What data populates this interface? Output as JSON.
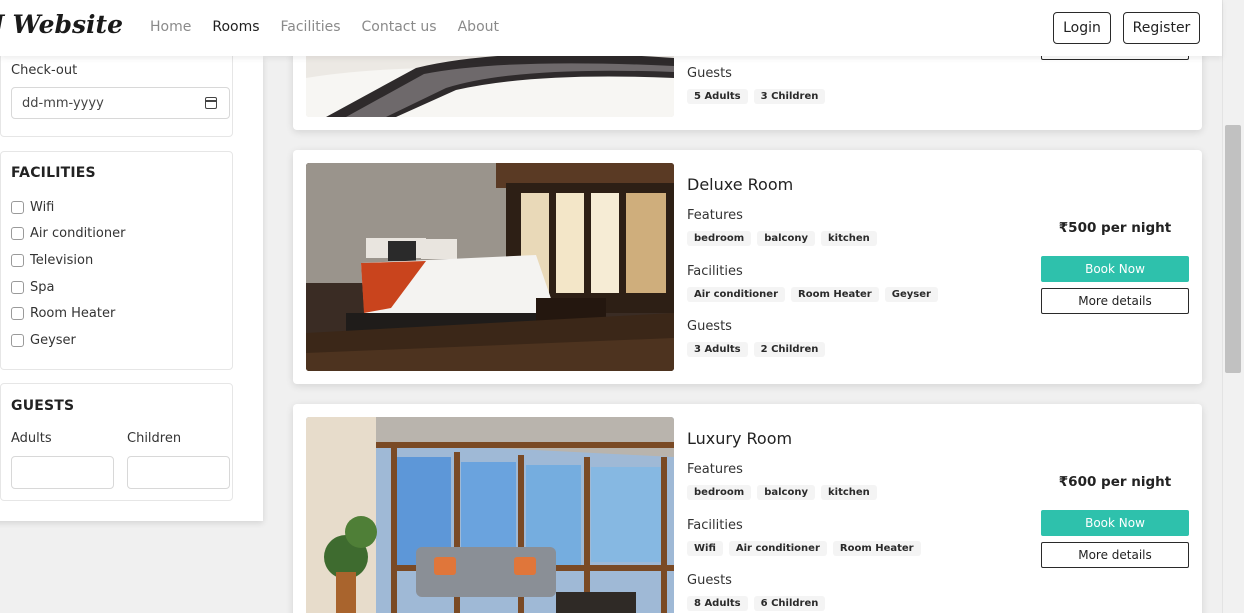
{
  "navbar": {
    "brand": "J Website",
    "links": [
      "Home",
      "Rooms",
      "Facilities",
      "Contact us",
      "About"
    ],
    "active_link": "Rooms",
    "login_label": "Login",
    "register_label": "Register"
  },
  "sidebar": {
    "checkout_label": "Check-out",
    "checkout_placeholder": "dd-mm-yyyy",
    "facilities_heading": "FACILITIES",
    "facilities": [
      "Wifi",
      "Air conditioner",
      "Television",
      "Spa",
      "Room Heater",
      "Geyser"
    ],
    "guests_heading": "GUESTS",
    "adults_label": "Adults",
    "children_label": "Children"
  },
  "rooms": [
    {
      "guests_label": "Guests",
      "guests": [
        "5 Adults",
        "3 Children"
      ]
    },
    {
      "title": "Deluxe Room",
      "features_label": "Features",
      "features": [
        "bedroom",
        "balcony",
        "kitchen"
      ],
      "facilities_label": "Facilities",
      "facilities": [
        "Air conditioner",
        "Room Heater",
        "Geyser"
      ],
      "guests_label": "Guests",
      "guests": [
        "3 Adults",
        "2 Children"
      ],
      "price": "₹500 per night",
      "book_label": "Book Now",
      "details_label": "More details"
    },
    {
      "title": "Luxury Room",
      "features_label": "Features",
      "features": [
        "bedroom",
        "balcony",
        "kitchen"
      ],
      "facilities_label": "Facilities",
      "facilities": [
        "Wifi",
        "Air conditioner",
        "Room Heater"
      ],
      "guests_label": "Guests",
      "guests": [
        "8 Adults",
        "6 Children"
      ],
      "price": "₹600 per night",
      "book_label": "Book Now",
      "details_label": "More details"
    }
  ],
  "colors": {
    "accent": "#2ec1ac",
    "page_bg": "#f0f0f0"
  }
}
